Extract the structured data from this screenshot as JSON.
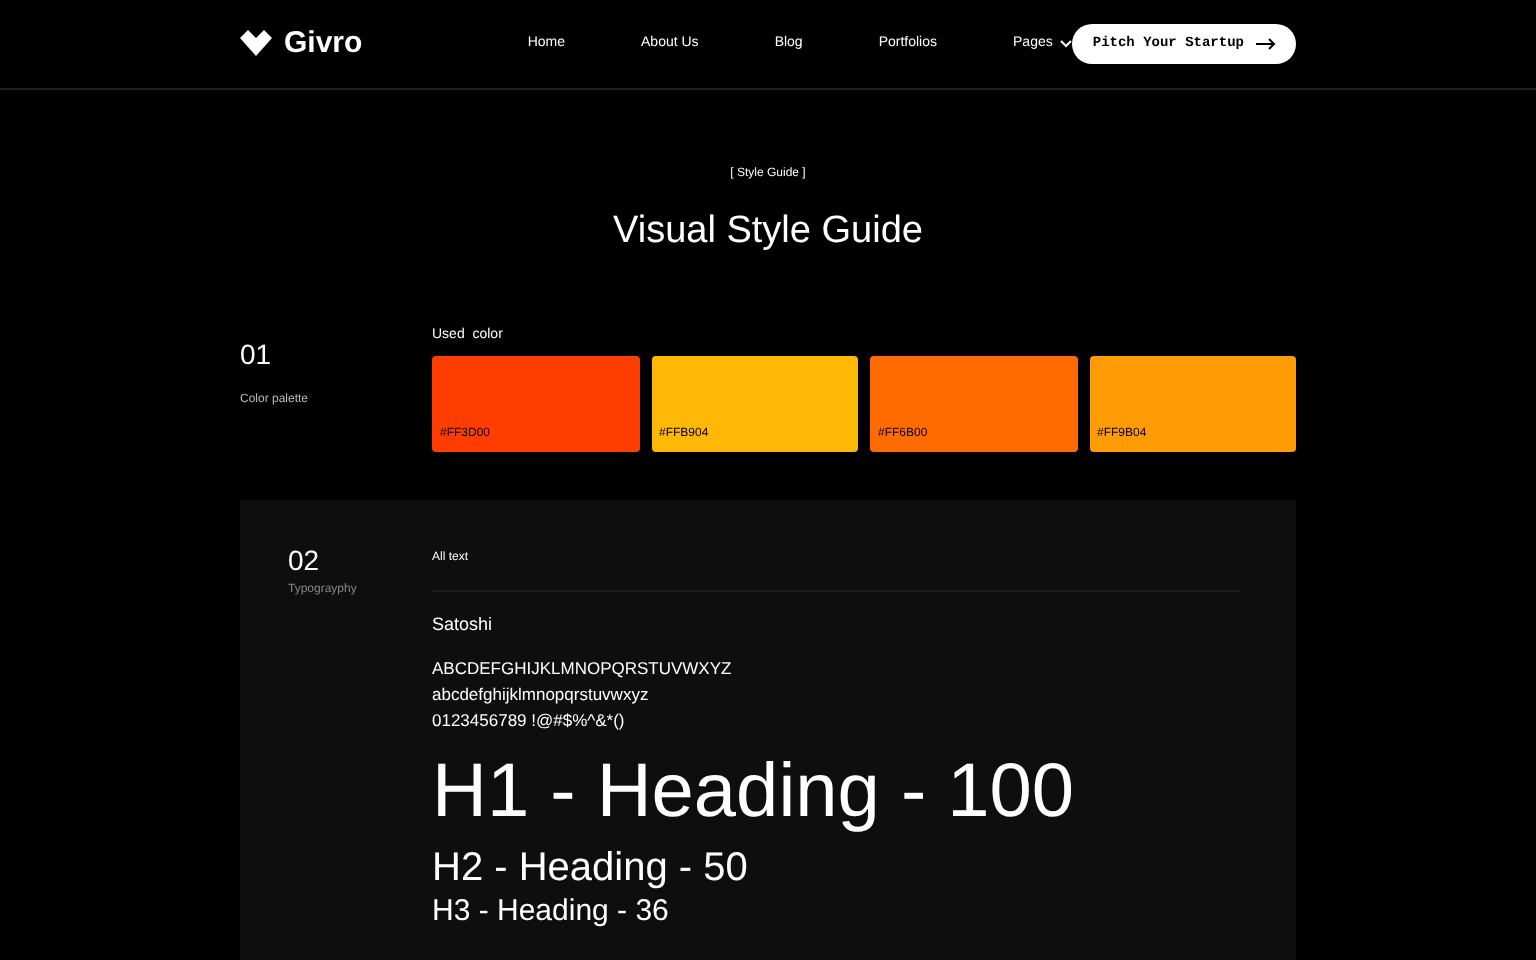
{
  "brand": {
    "name": "Givro"
  },
  "nav": {
    "items": [
      {
        "label": "Home",
        "kind": "link"
      },
      {
        "label": "About Us",
        "kind": "link"
      },
      {
        "label": "Blog",
        "kind": "link"
      },
      {
        "label": "Portfolios",
        "kind": "link"
      },
      {
        "label": "Pages",
        "kind": "dropdown"
      }
    ],
    "cta": "Pitch Your Startup"
  },
  "hero": {
    "eyebrow": "[ Style Guide ]",
    "title": "Visual Style Guide"
  },
  "palette": {
    "number": "01",
    "name": "Color palette",
    "heading": "Used  color",
    "swatches": [
      {
        "label": "#FF3D00",
        "color": "#ff3d00"
      },
      {
        "label": "#FFB904",
        "color": "#ffb904"
      },
      {
        "label": "#FF6B00",
        "color": "#ff6b00"
      },
      {
        "label": "#FF9B04",
        "color": "#ff9b04"
      }
    ]
  },
  "typography": {
    "number": "02",
    "name": "Typograyphy",
    "heading": "All text",
    "font_name": "Satoshi",
    "samples": [
      "ABCDEFGHIJKLMNOPQRSTUVWXYZ",
      "abcdefghijklmnopqrstuvwxyz",
      "0123456789 !@#$%^&*()"
    ],
    "headings": [
      {
        "label": "H1 - Heading - 100",
        "kind": "h1"
      },
      {
        "label": "H2 - Heading - 50",
        "kind": "h2"
      },
      {
        "label": "H3 - Heading - 36",
        "kind": "h3"
      }
    ]
  }
}
